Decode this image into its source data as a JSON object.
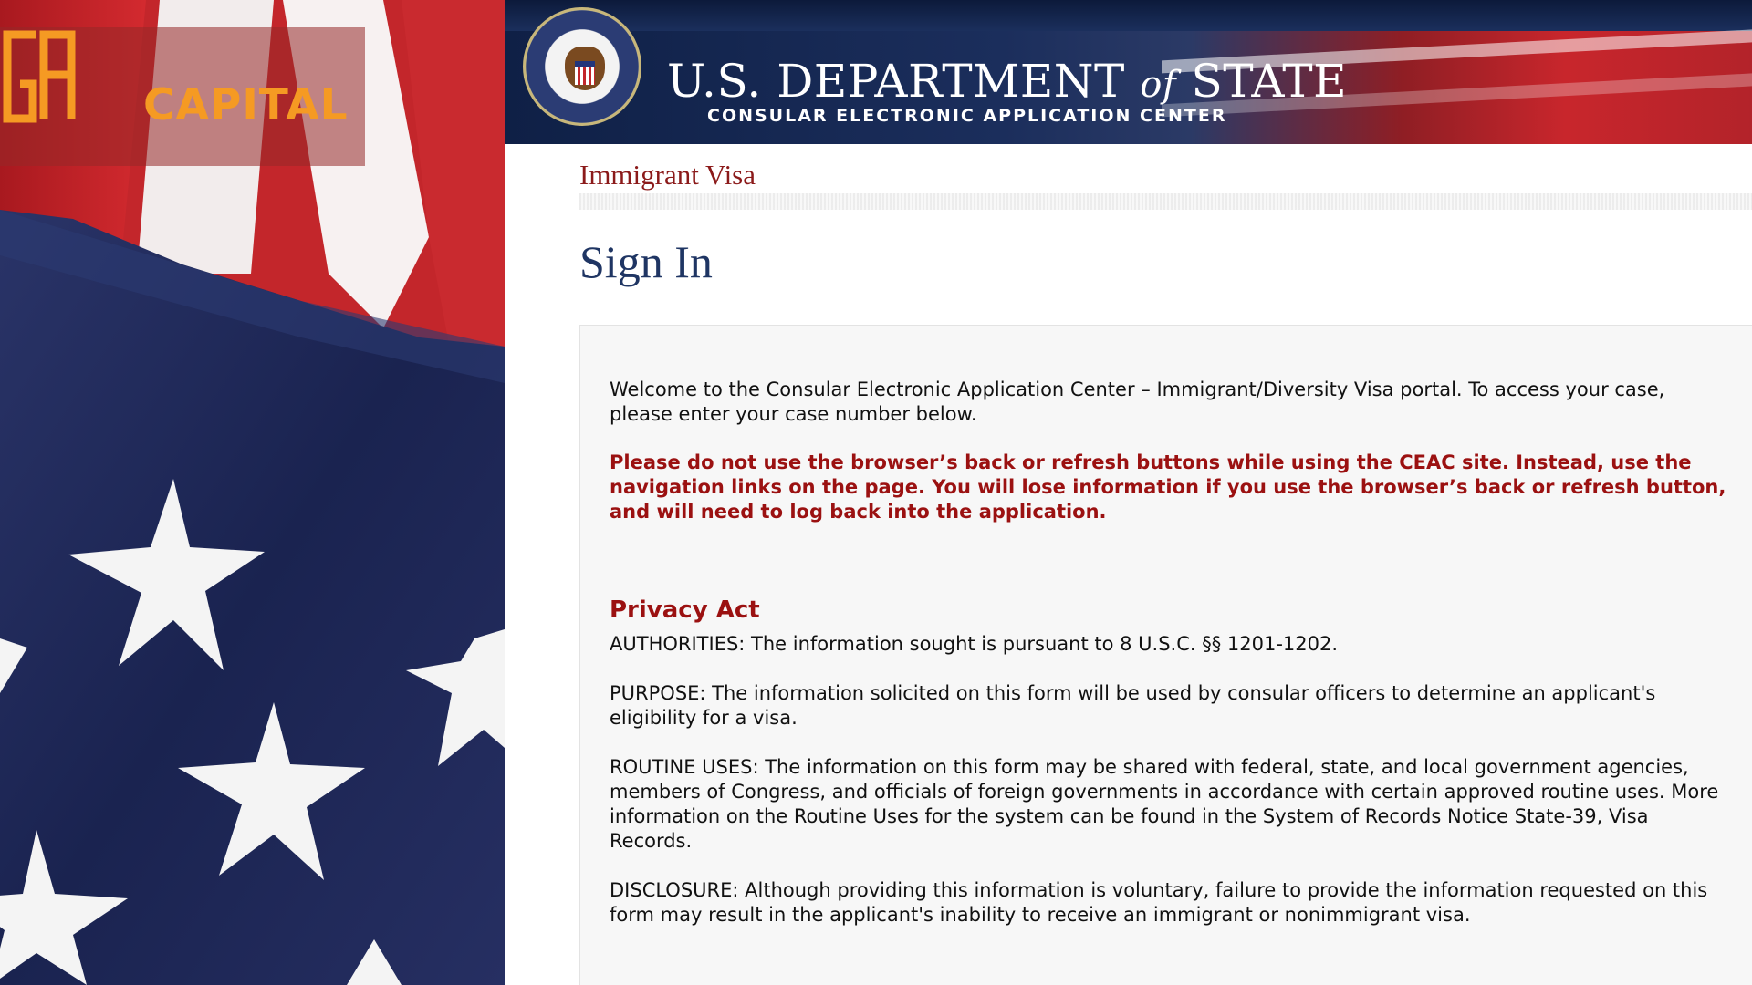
{
  "logo": {
    "text": "CAPITAL",
    "mark_icon": "gh-monogram-icon",
    "color": "#f59a23"
  },
  "banner": {
    "seal_icon": "department-of-state-seal-icon",
    "title_part1": "U.S. DEPARTMENT ",
    "title_of": "of",
    "title_part2": " STATE",
    "subtitle": "CONSULAR ELECTRONIC APPLICATION CENTER"
  },
  "section": {
    "title": "Immigrant Visa"
  },
  "page": {
    "title": "Sign In"
  },
  "content": {
    "welcome": "Welcome to the Consular Electronic Application Center – Immigrant/Diversity Visa portal. To access your case, please enter your case number below.",
    "warning": "Please do not use the browser’s back or refresh buttons while using the CEAC site. Instead, use the navigation links on the page. You will lose information if you use the browser’s back or refresh button, and will need to log back into the application.",
    "privacy_heading": "Privacy Act",
    "authorities": "AUTHORITIES: The information sought is pursuant to 8 U.S.C. §§ 1201-1202.",
    "purpose": "PURPOSE: The information solicited on this form will be used by consular officers to determine an applicant's eligibility for a visa.",
    "routine_uses": "ROUTINE USES: The information on this form may be shared with federal, state, and local government agencies, members of Congress, and officials of foreign governments in accordance with certain approved routine uses. More information on the Routine Uses for the system can be found in the System of Records Notice State-39, Visa Records.",
    "disclosure": "DISCLOSURE: Although providing this information is voluntary, failure to provide the information requested on this form may result in the applicant's inability to receive an immigrant or nonimmigrant visa."
  },
  "colors": {
    "warning": "#9b1111",
    "title_blue": "#1f3563",
    "section_red": "#8b1a1a"
  }
}
